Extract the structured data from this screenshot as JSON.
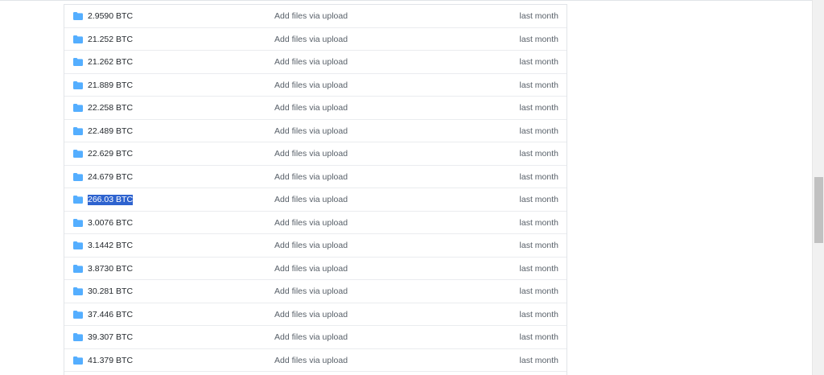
{
  "files": [
    {
      "name": "2.9590 BTC",
      "message": "Add files via upload",
      "age": "last month"
    },
    {
      "name": "21.252 BTC",
      "message": "Add files via upload",
      "age": "last month"
    },
    {
      "name": "21.262 BTC",
      "message": "Add files via upload",
      "age": "last month"
    },
    {
      "name": "21.889 BTC",
      "message": "Add files via upload",
      "age": "last month"
    },
    {
      "name": "22.258 BTC",
      "message": "Add files via upload",
      "age": "last month"
    },
    {
      "name": "22.489 BTC",
      "message": "Add files via upload",
      "age": "last month"
    },
    {
      "name": "22.629 BTC",
      "message": "Add files via upload",
      "age": "last month"
    },
    {
      "name": "24.679 BTC",
      "message": "Add files via upload",
      "age": "last month"
    },
    {
      "name": "266.03 BTC",
      "message": "Add files via upload",
      "age": "last month",
      "selected": true
    },
    {
      "name": "3.0076 BTC",
      "message": "Add files via upload",
      "age": "last month"
    },
    {
      "name": "3.1442 BTC",
      "message": "Add files via upload",
      "age": "last month"
    },
    {
      "name": "3.8730 BTC",
      "message": "Add files via upload",
      "age": "last month"
    },
    {
      "name": "30.281 BTC",
      "message": "Add files via upload",
      "age": "last month"
    },
    {
      "name": "37.446 BTC",
      "message": "Add files via upload",
      "age": "last month"
    },
    {
      "name": "39.307 BTC",
      "message": "Add files via upload",
      "age": "last month"
    },
    {
      "name": "41.379 BTC",
      "message": "Add files via upload",
      "age": "last month"
    }
  ],
  "icons": {
    "folder": "folder-icon"
  },
  "colors": {
    "folder": "#54aeff",
    "selection": "#2e63cf"
  }
}
